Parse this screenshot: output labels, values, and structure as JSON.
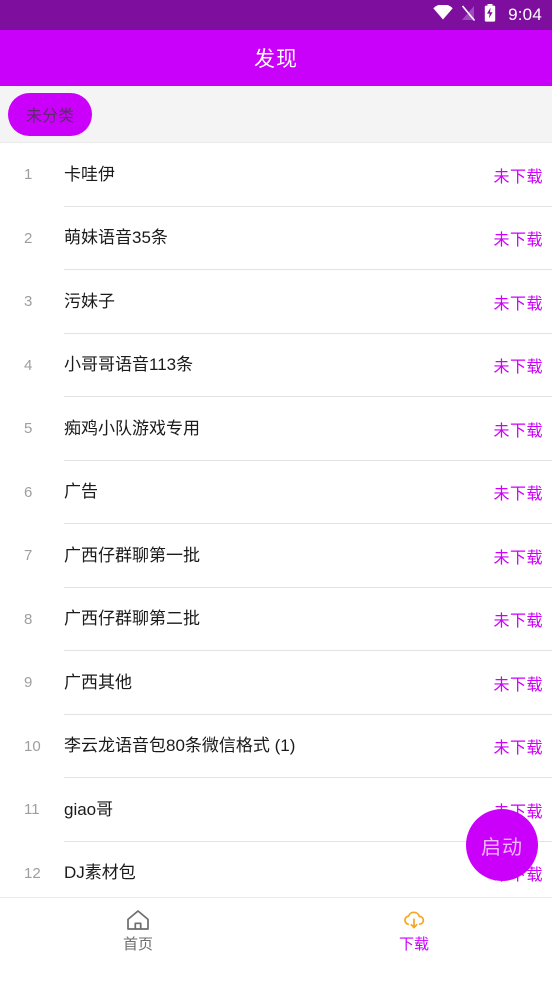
{
  "status_bar": {
    "time": "9:04",
    "icons": [
      "wifi-icon",
      "signal-off-icon",
      "battery-charging-icon"
    ],
    "background": "#7d0e9e"
  },
  "app_bar": {
    "title": "发现",
    "background": "#c900fa",
    "title_color": "#ffffff"
  },
  "chips": {
    "items": [
      {
        "label": "未分类",
        "selected": true
      }
    ],
    "chip_color": "#cb00fb",
    "bar_background": "#f4f4f4"
  },
  "list": {
    "status_color": "#cc00fb",
    "rows": [
      {
        "index": "1",
        "title": "卡哇伊",
        "status": "未下载"
      },
      {
        "index": "2",
        "title": "萌妹语音35条",
        "status": "未下载"
      },
      {
        "index": "3",
        "title": "污妹子",
        "status": "未下载"
      },
      {
        "index": "4",
        "title": "小哥哥语音113条",
        "status": "未下载"
      },
      {
        "index": "5",
        "title": "痴鸡小队游戏专用",
        "status": "未下载"
      },
      {
        "index": "6",
        "title": "广告",
        "status": "未下载"
      },
      {
        "index": "7",
        "title": "广西仔群聊第一批",
        "status": "未下载"
      },
      {
        "index": "8",
        "title": "广西仔群聊第二批",
        "status": "未下载"
      },
      {
        "index": "9",
        "title": "广西其他",
        "status": "未下载"
      },
      {
        "index": "10",
        "title": "李云龙语音包80条微信格式 (1)",
        "status": "未下载"
      },
      {
        "index": "11",
        "title": "giao哥",
        "status": "未下载"
      },
      {
        "index": "12",
        "title": "DJ素材包",
        "status": "未下载"
      }
    ]
  },
  "fab": {
    "label": "启动",
    "background": "#cb00fb",
    "text_color": "#f2b8ff"
  },
  "bottom_nav": {
    "items": [
      {
        "label": "首页",
        "icon": "home-icon",
        "active": false,
        "color": "#6d6d6d"
      },
      {
        "label": "下载",
        "icon": "cloud-download-icon",
        "active": true,
        "color": "#cb00fb",
        "icon_color": "#f5a623"
      }
    ]
  }
}
